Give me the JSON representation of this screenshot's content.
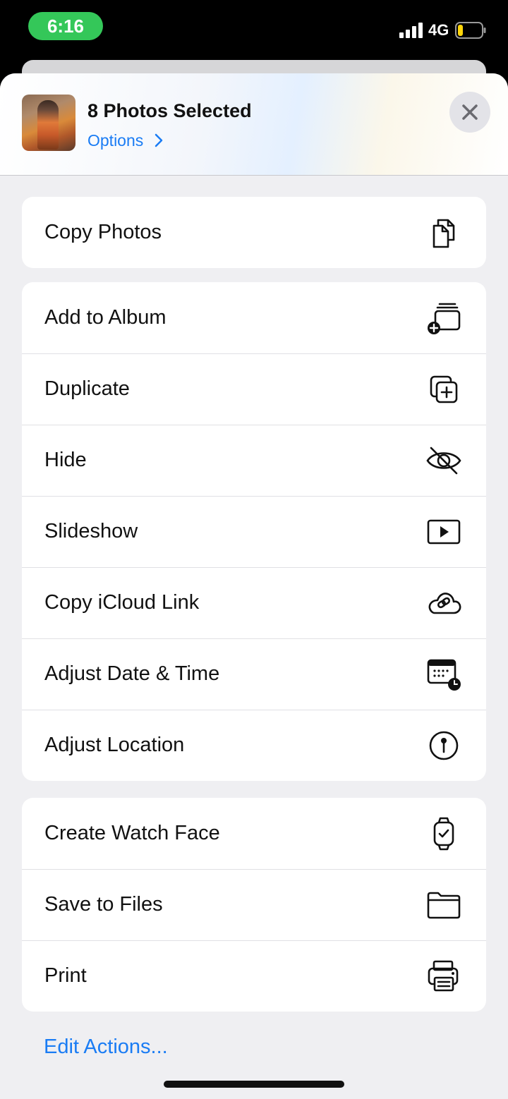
{
  "status_bar": {
    "time": "6:16",
    "network": "4G",
    "time_pill_color": "#34c759",
    "battery_level": 0.15,
    "battery_color": "#ffd60a"
  },
  "header": {
    "title": "8 Photos Selected",
    "options_label": "Options",
    "close_icon": "close-icon",
    "thumbnail_icon": "photo-thumbnail"
  },
  "groups": [
    {
      "items": [
        {
          "label": "Copy Photos",
          "icon": "copy-icon"
        }
      ]
    },
    {
      "items": [
        {
          "label": "Add to Album",
          "icon": "add-to-album-icon"
        },
        {
          "label": "Duplicate",
          "icon": "duplicate-icon"
        },
        {
          "label": "Hide",
          "icon": "eye-slash-icon"
        },
        {
          "label": "Slideshow",
          "icon": "play-rectangle-icon"
        },
        {
          "label": "Copy iCloud Link",
          "icon": "cloud-link-icon"
        },
        {
          "label": "Adjust Date & Time",
          "icon": "calendar-clock-icon"
        },
        {
          "label": "Adjust Location",
          "icon": "location-pin-icon"
        }
      ]
    },
    {
      "items": [
        {
          "label": "Create Watch Face",
          "icon": "watch-icon"
        },
        {
          "label": "Save to Files",
          "icon": "folder-icon"
        },
        {
          "label": "Print",
          "icon": "printer-icon"
        }
      ]
    }
  ],
  "footer": {
    "edit_actions_label": "Edit Actions..."
  },
  "colors": {
    "accent": "#1a7cf4",
    "sheet_background": "#efeff2"
  }
}
